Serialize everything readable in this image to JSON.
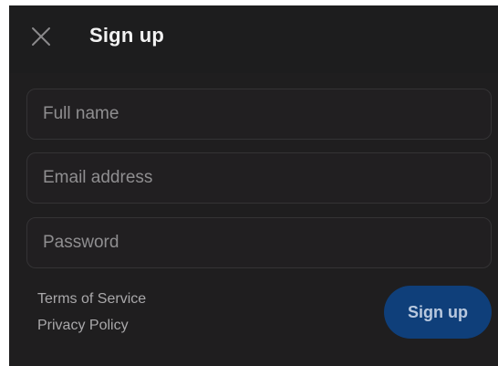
{
  "header": {
    "title": "Sign up",
    "close_icon": "close-icon"
  },
  "form": {
    "full_name": {
      "value": "",
      "placeholder": "Full name"
    },
    "email": {
      "value": "",
      "placeholder": "Email address"
    },
    "password": {
      "value": "",
      "placeholder": "Password"
    }
  },
  "links": {
    "terms": "Terms of Service",
    "privacy": "Privacy Policy"
  },
  "actions": {
    "submit_label": "Sign up"
  },
  "colors": {
    "background": "#1f1e1f",
    "header_background": "#1d1d1e",
    "field_border": "#343335",
    "submit_background": "#0f3f7a",
    "submit_text": "#b9c9df"
  }
}
